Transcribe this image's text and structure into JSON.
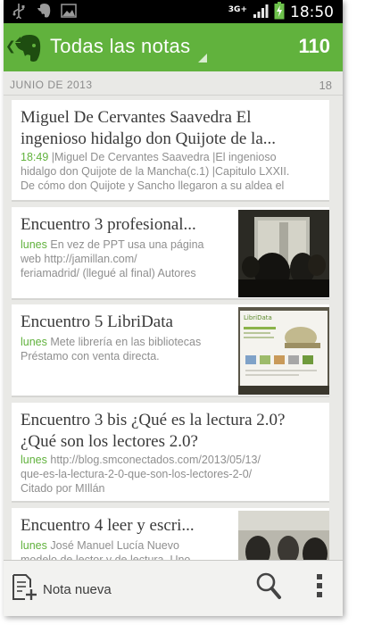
{
  "status_bar": {
    "icons": [
      "usb-icon",
      "evernote-elephant-icon",
      "image-icon"
    ],
    "network": "3G+",
    "time": "18:50"
  },
  "action_bar": {
    "title": "Todas las notas",
    "count": "110",
    "accent": "#61b23d"
  },
  "section": {
    "label": "JUNIO DE 2013",
    "count": "18"
  },
  "notes": [
    {
      "title_line1": "Miguel  De Cervantes Saavedra El",
      "title_line2": "ingenioso hidalgo don Quijote de la...",
      "date": "18:49",
      "snippet_line1": " |Miguel De Cervantes Saavedra |El ingenioso",
      "snippet_line2": "hidalgo don Quijote de la Mancha(c.1) |Capitulo LXXII.",
      "snippet_line3": "De cómo don Quijote y Sancho llegaron a su aldea el"
    },
    {
      "title": "Encuentro 3 profesional...",
      "date": "lunes",
      "snippet_line1": " En vez de PPT usa una página",
      "snippet_line2": "web http://jamillan.com/",
      "snippet_line3": "feriamadrid/ (llegué al final) Autores"
    },
    {
      "title": "Encuentro 5 LibriData",
      "date": "lunes",
      "snippet_line1": " Mete librería en las bibliotecas",
      "snippet_line2": "Préstamo con venta directa.",
      "thumb_text": "LibriData"
    },
    {
      "title_line1": "Encuentro 3 bis ¿Qué es la lectura 2.0?",
      "title_line2": "¿Qué son los lectores 2.0?",
      "date": "lunes",
      "snippet_line1": " http://blog.smconectados.com/2013/05/13/",
      "snippet_line2": "que-es-la-lectura-2-0-que-son-los-lectores-2-0/",
      "snippet_line3": "Citado por MIllán"
    },
    {
      "title": "Encuentro 4 leer y escri...",
      "date": "lunes",
      "snippet_line1": " José Manuel Lucía  Nuevo",
      "snippet_line2": "modelo de lector y de lectura. Uno"
    }
  ],
  "bottom_bar": {
    "new_note_label": "Nota nueva"
  }
}
